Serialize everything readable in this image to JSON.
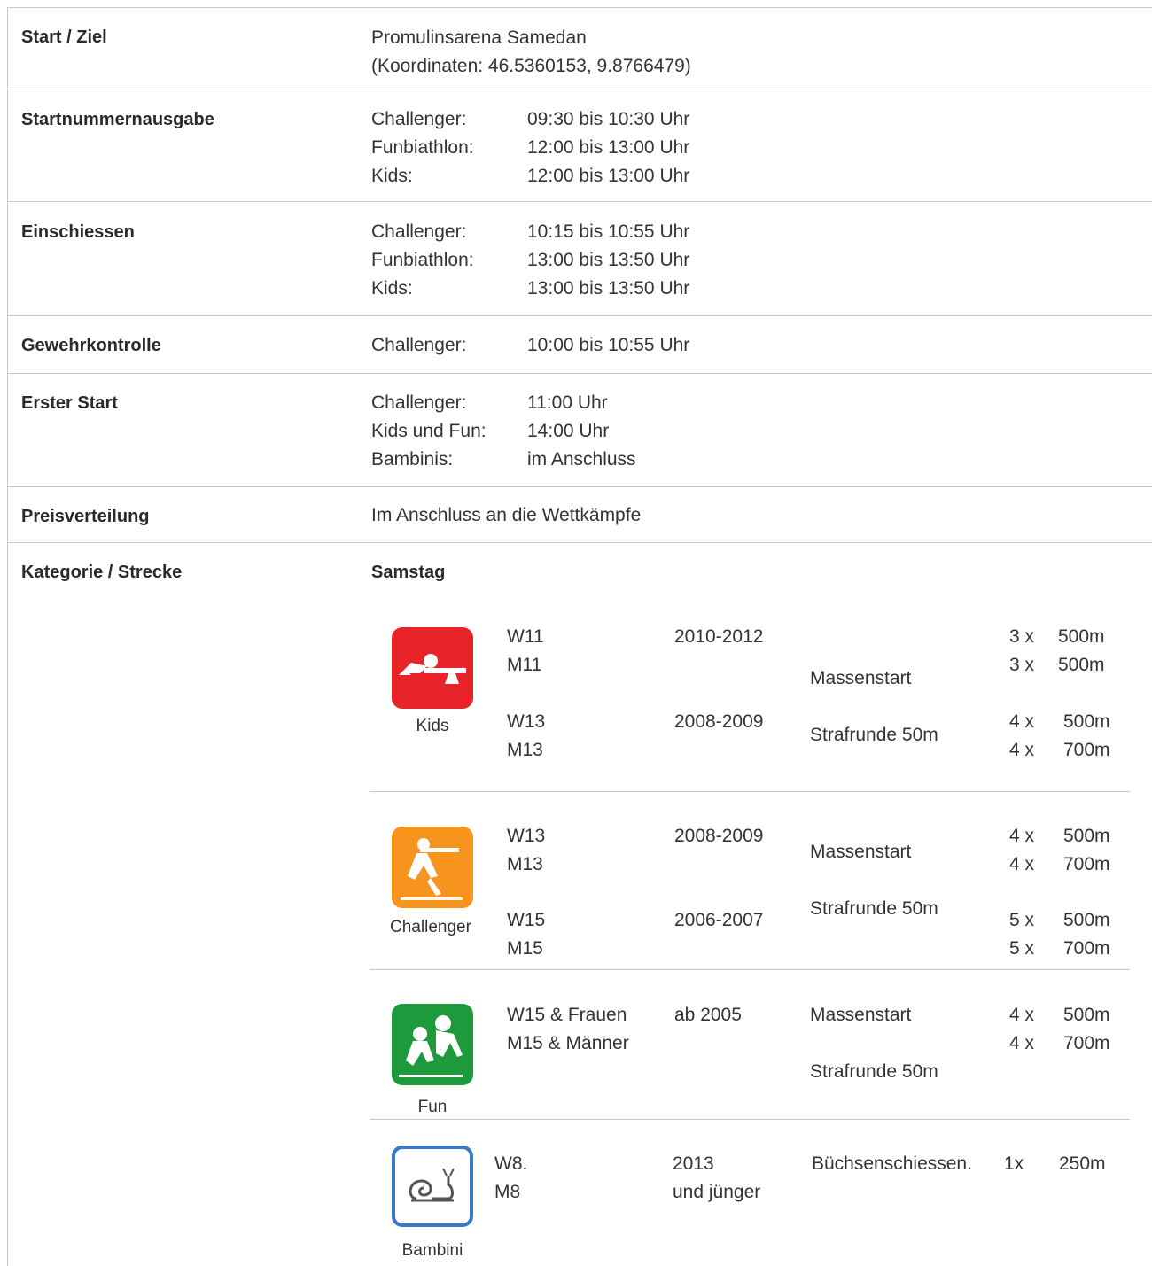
{
  "rows": {
    "start": {
      "label": "Start / Ziel",
      "line1": "Promulinsarena Samedan",
      "line2": "(Koordinaten: 46.5360153, 9.8766479)"
    },
    "startnr": {
      "label": "Startnummernausgabe",
      "items": [
        {
          "k": "Challenger:",
          "v": "09:30 bis 10:30 Uhr"
        },
        {
          "k": "Funbiathlon:",
          "v": "12:00 bis 13:00 Uhr"
        },
        {
          "k": "Kids:",
          "v": "12:00 bis 13:00 Uhr"
        }
      ]
    },
    "einschiessen": {
      "label": "Einschiessen",
      "items": [
        {
          "k": "Challenger:",
          "v": "10:15 bis 10:55 Uhr"
        },
        {
          "k": "Funbiathlon:",
          "v": "13:00 bis 13:50 Uhr"
        },
        {
          "k": "Kids:",
          "v": "13:00 bis 13:50 Uhr"
        }
      ]
    },
    "gewehr": {
      "label": "Gewehrkontrolle",
      "items": [
        {
          "k": "Challenger:",
          "v": "10:00 bis 10:55 Uhr"
        }
      ]
    },
    "erster": {
      "label": "Erster Start",
      "items": [
        {
          "k": "Challenger:",
          "v": "11:00 Uhr"
        },
        {
          "k": "Kids und Fun:",
          "v": "14:00 Uhr"
        },
        {
          "k": "Bambinis:",
          "v": "im Anschluss"
        }
      ]
    },
    "preis": {
      "label": "Preisverteilung",
      "value": "Im Anschluss an die Wettkämpfe"
    },
    "kategorie": {
      "label": "Kategorie / Strecke",
      "day": "Samstag"
    }
  },
  "categories": {
    "kids": {
      "name": "Kids",
      "color": "#e8232a",
      "c1": "W11",
      "c2": "M11",
      "y1": "2010-2012",
      "c3": "W13",
      "c4": "M13",
      "y2": "2008-2009",
      "mode1": "Massenstart",
      "mode2": "Strafrunde 50m",
      "d": [
        [
          "3 x",
          "500m"
        ],
        [
          "3 x",
          "500m"
        ],
        [
          "4 x",
          "500m"
        ],
        [
          "4 x",
          "700m"
        ]
      ]
    },
    "challenger": {
      "name": "Challenger",
      "color": "#f7941d",
      "c1": "W13",
      "c2": "M13",
      "y1": "2008-2009",
      "c3": "W15",
      "c4": "M15",
      "y2": "2006-2007",
      "mode1": "Massenstart",
      "mode2": "Strafrunde 50m",
      "d": [
        [
          "4 x",
          "500m"
        ],
        [
          "4 x",
          "700m"
        ],
        [
          "5 x",
          "500m"
        ],
        [
          "5 x",
          "700m"
        ]
      ]
    },
    "fun": {
      "name": "Fun",
      "color": "#1e9a3c",
      "c1": "W15 & Frauen",
      "c2": "M15 & Männer",
      "y1": "ab 2005",
      "mode1": "Massenstart",
      "mode2": "Strafrunde 50m",
      "d": [
        [
          "4 x",
          "500m"
        ],
        [
          "4 x",
          "700m"
        ]
      ]
    },
    "bambini": {
      "name": "Bambini",
      "color": "#3a78c9",
      "c1": "W8.",
      "c2": "M8",
      "y1": "2013",
      "y1b": "und jünger",
      "mode1": "Büchsenschiessen.",
      "d": [
        [
          "1x",
          "250m"
        ]
      ]
    }
  }
}
